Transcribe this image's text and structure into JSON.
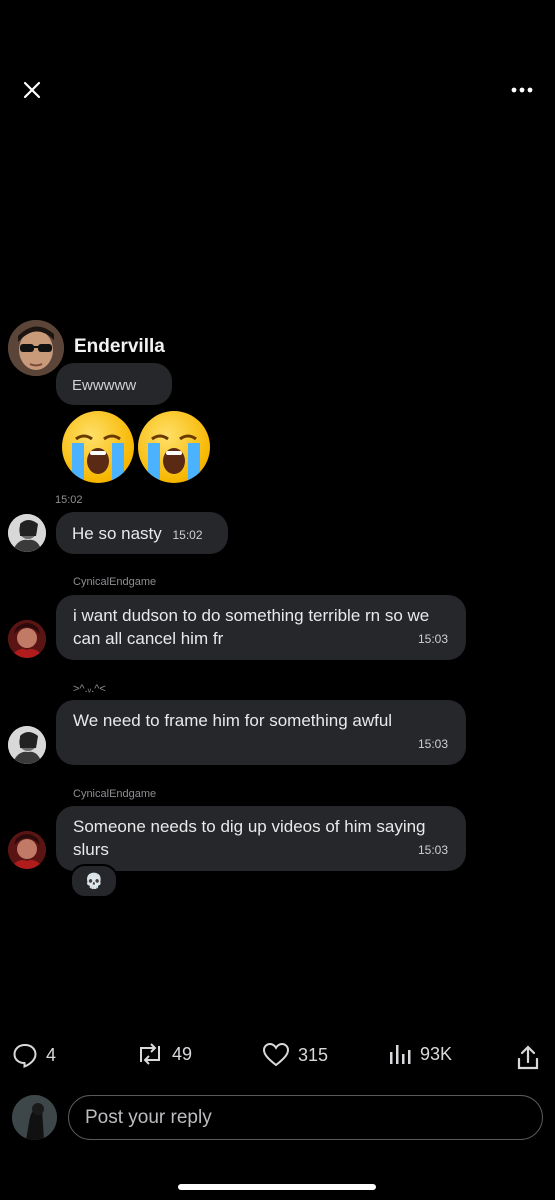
{
  "header": {
    "close_icon": "close-icon",
    "more_icon": "more-dots-icon"
  },
  "chat": {
    "group_name": "Endervilla",
    "first_message": "Ewwwww",
    "emoji_reaction": [
      "loudly-crying-face",
      "loudly-crying-face"
    ],
    "separator_time": "15:02",
    "messages": [
      {
        "sender": "",
        "text": "He so nasty",
        "time": "15:02"
      },
      {
        "sender": "CynicalEndgame",
        "text": "i want dudson to do something terrible rn so we can all cancel him fr",
        "time": "15:03"
      },
      {
        "sender": ">^.ᵥ.^<",
        "text": "We need to frame him for something awful",
        "time": "15:03"
      },
      {
        "sender": "CynicalEndgame",
        "text": "Someone needs to dig up videos of him saying slurs",
        "time": "15:03",
        "reaction": "💀"
      }
    ]
  },
  "actions": {
    "replies": "4",
    "reposts": "49",
    "likes": "315",
    "views": "93K"
  },
  "reply": {
    "placeholder": "Post your reply"
  },
  "colors": {
    "bg": "#000000",
    "bubble": "#26272b",
    "muted": "#8e8e93"
  }
}
